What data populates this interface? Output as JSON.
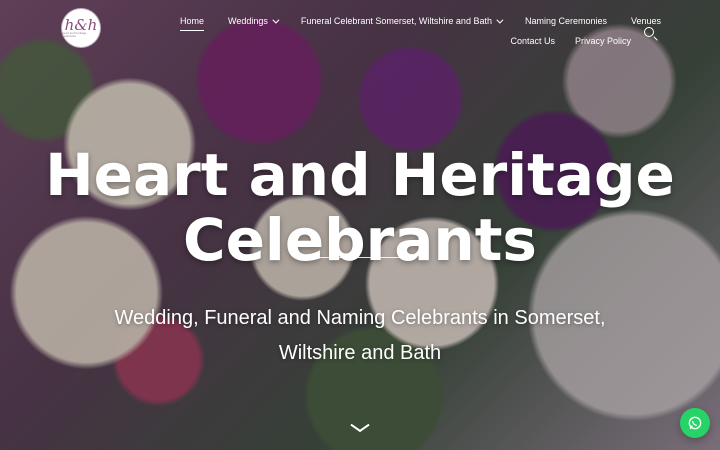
{
  "logo": {
    "mark": "h&h",
    "tagline": "heart and heritage celebrants"
  },
  "nav": {
    "items": [
      {
        "label": "Home",
        "active": true
      },
      {
        "label": "Weddings",
        "dropdown": true
      },
      {
        "label": "Funeral Celebrant Somerset, Wiltshire and Bath",
        "dropdown": true
      },
      {
        "label": "Naming Ceremonies"
      },
      {
        "label": "Venues"
      },
      {
        "label": "Contact Us"
      },
      {
        "label": "Privacy Policy"
      }
    ]
  },
  "hero": {
    "title": "Heart and Heritage Celebrants",
    "subtitle": "Wedding, Funeral and Naming Celebrants in Somerset, Wiltshire and Bath"
  },
  "icons": {
    "search": "search-icon",
    "scroll": "chevron-down-icon",
    "chat": "whatsapp-icon"
  },
  "colors": {
    "accent": "#25d366",
    "text": "#ffffff"
  }
}
